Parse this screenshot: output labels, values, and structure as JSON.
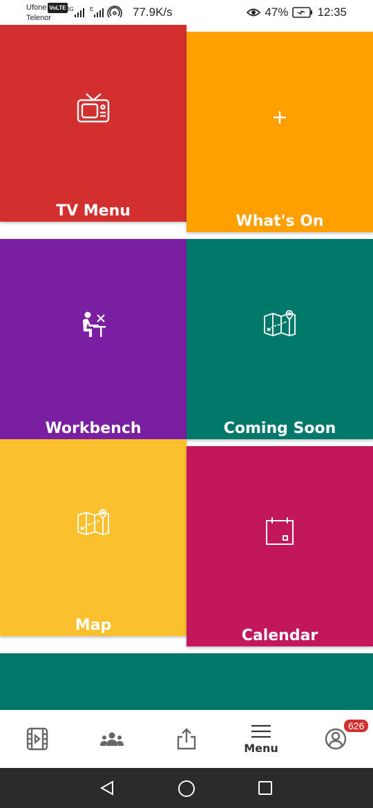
{
  "status": {
    "carrier1": "Ufone",
    "volte": "VoLTE",
    "carrier2": "Telenor",
    "net_4g": "4G",
    "net_e": "E",
    "speed": "77.9K/s",
    "battery": "47%",
    "time": "12:35"
  },
  "tiles": {
    "tv_menu": {
      "label": "TV Menu",
      "color": "#d32f2f",
      "icon": "tv-icon"
    },
    "whats_on": {
      "label": "What's On",
      "color": "#ffa000",
      "icon": "plus-icon"
    },
    "workbench": {
      "label": "Workbench",
      "color": "#7b1fa2",
      "icon": "workbench-icon"
    },
    "coming_soon": {
      "label": "Coming Soon",
      "color": "#00796b",
      "icon": "map-icon"
    },
    "map": {
      "label": "Map",
      "color": "#fbc02d",
      "icon": "map-icon"
    },
    "calendar": {
      "label": "Calendar",
      "color": "#c2185b",
      "icon": "calendar-icon"
    },
    "partial": {
      "color": "#00796b"
    }
  },
  "nav": {
    "menu_label": "Menu",
    "badge_count": "626"
  }
}
